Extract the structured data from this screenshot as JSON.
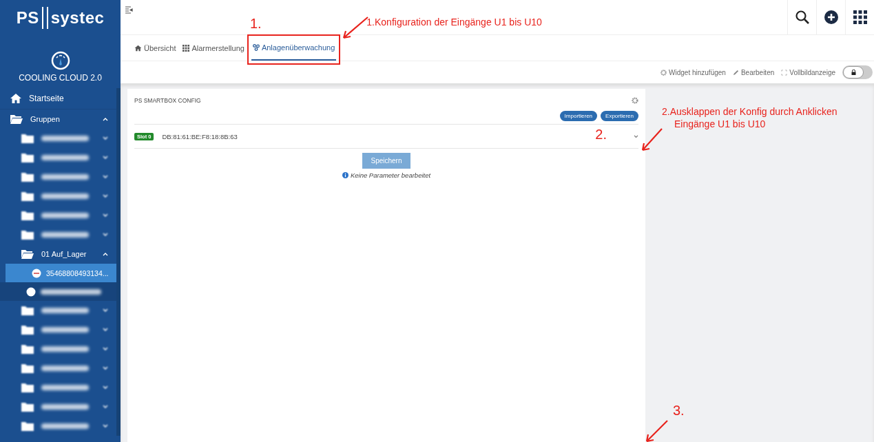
{
  "sidebar": {
    "logo": {
      "left": "PS",
      "right": "systec"
    },
    "product": "COOLING CLOUD 2.0",
    "items": [
      {
        "kind": "home",
        "label": "Startseite"
      },
      {
        "kind": "folder",
        "label": "Gruppen",
        "expanded": true,
        "children": [
          {
            "kind": "redacted_folder",
            "expanded": false
          },
          {
            "kind": "redacted_folder",
            "expanded": false
          },
          {
            "kind": "redacted_folder",
            "expanded": false
          },
          {
            "kind": "redacted_folder",
            "expanded": false
          },
          {
            "kind": "redacted_folder",
            "expanded": false
          },
          {
            "kind": "redacted_folder",
            "expanded": false
          },
          {
            "kind": "folder",
            "label": "01 Auf_Lager",
            "expanded": true,
            "children": [
              {
                "kind": "device",
                "label": "35468808493134...",
                "selected": true
              },
              {
                "kind": "redacted_device",
                "selected": false
              }
            ]
          },
          {
            "kind": "redacted_folder",
            "expanded": false
          },
          {
            "kind": "redacted_folder",
            "expanded": false
          },
          {
            "kind": "redacted_folder",
            "expanded": false
          },
          {
            "kind": "redacted_folder",
            "expanded": false
          },
          {
            "kind": "redacted_folder",
            "expanded": false
          },
          {
            "kind": "redacted_folder",
            "expanded": false
          },
          {
            "kind": "redacted_folder",
            "expanded": false
          }
        ]
      }
    ]
  },
  "tabs": [
    {
      "label": "Übersicht",
      "kind": "home",
      "selected": false
    },
    {
      "label": "Alarmerstellung",
      "kind": "alarms",
      "selected": false
    },
    {
      "label": "Anlagenüberwachung",
      "kind": "monitoring",
      "selected": true
    }
  ],
  "toolbar": [
    {
      "label": "Widget hinzufügen",
      "kind": "add_widget"
    },
    {
      "label": "Bearbeiten",
      "kind": "edit"
    },
    {
      "label": "Vollbildanzeige",
      "kind": "fullscreen"
    }
  ],
  "lock_toggle": {
    "on": false
  },
  "card": {
    "title": "PS SMARTBOX CONFIG",
    "buttons": [
      "Importieren",
      "Exportieren"
    ],
    "row": {
      "badge": "Slot 0",
      "address": "DB:81:61:BE:F8:18:8B:63",
      "expanded": false
    },
    "save_button": {
      "label": "Speichern",
      "disabled": true
    },
    "info": "Keine Parameter bearbeitet"
  },
  "annotations": [
    {
      "kind": "tab",
      "number": "1.",
      "text": "1.Konfiguration der Eingänge U1 bis U10"
    },
    {
      "kind": "row",
      "number": "2.",
      "text": "2.Ausklappen der Konfig durch Anklicken",
      "text_2": "Eingänge U1 bis U10"
    },
    {
      "kind": "bottom",
      "number": "3."
    }
  ]
}
